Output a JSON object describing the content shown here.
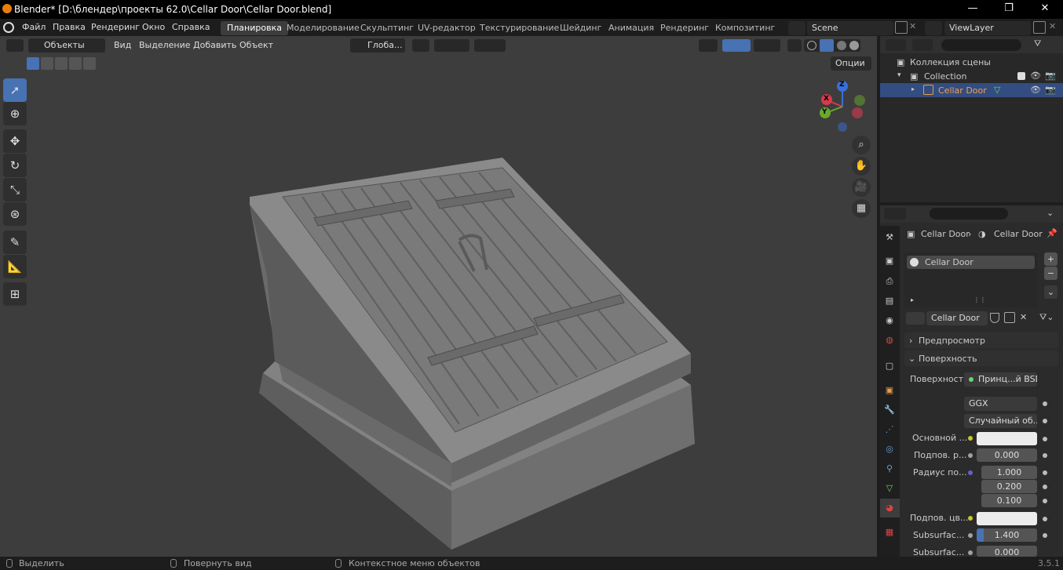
{
  "window": {
    "title": "Blender* [D:\\блендер\\проекты 62.0\\Cellar Door\\Cellar Door.blend]",
    "minimize": "—",
    "maximize": "❐",
    "close": "✕"
  },
  "menu": {
    "items": [
      "Файл",
      "Правка",
      "Рендеринг",
      "Окно",
      "Справка"
    ]
  },
  "workspaces": {
    "tabs": [
      "Планировка",
      "Моделирование",
      "Скульптинг",
      "UV-редактор",
      "Текстурирование",
      "Шейдинг",
      "Анимация",
      "Рендеринг",
      "Композитинг"
    ],
    "active": "Планировка"
  },
  "scene": {
    "name": "Scene",
    "view_layer": "ViewLayer"
  },
  "viewport": {
    "mode": "Объекты",
    "menus": [
      "Вид",
      "Выделение",
      "Добавить",
      "Объект"
    ],
    "orientation": "Глоба...",
    "options": "Опции",
    "gizmo": {
      "x": "X",
      "y": "Y",
      "z": "Z"
    },
    "accent": "#4772b3"
  },
  "outliner": {
    "scene_collection": "Коллекция сцены",
    "collection": "Collection",
    "object": "Cellar Door"
  },
  "properties": {
    "breadcrumb_object": "Cellar Door",
    "breadcrumb_material": "Cellar Door",
    "slot": "Cellar Door",
    "material_name": "Cellar Door",
    "preview": "Предпросмотр",
    "surface_panel": "Поверхность",
    "surface_label": "Поверхность",
    "surface_value": "Принц...й BSDF",
    "distribution": "GGX",
    "subsurface_method": "Случайный об...",
    "base_color": "Основной ...",
    "subsurface_label": "Подпов. р...",
    "subsurface_value": "0.000",
    "radius_label": "Радиус по...",
    "radius": [
      "1.000",
      "0.200",
      "0.100"
    ],
    "subsurface_color": "Подпов. цв...",
    "subsurface_ior_label": "Subsurfac...",
    "subsurface_ior": "1.400",
    "subsurface_aniso_label": "Subsurfac...",
    "subsurface_aniso": "0.000"
  },
  "status": {
    "select": "Выделить",
    "rotate": "Повернуть вид",
    "context": "Контекстное меню объектов",
    "version": "3.5.1"
  }
}
